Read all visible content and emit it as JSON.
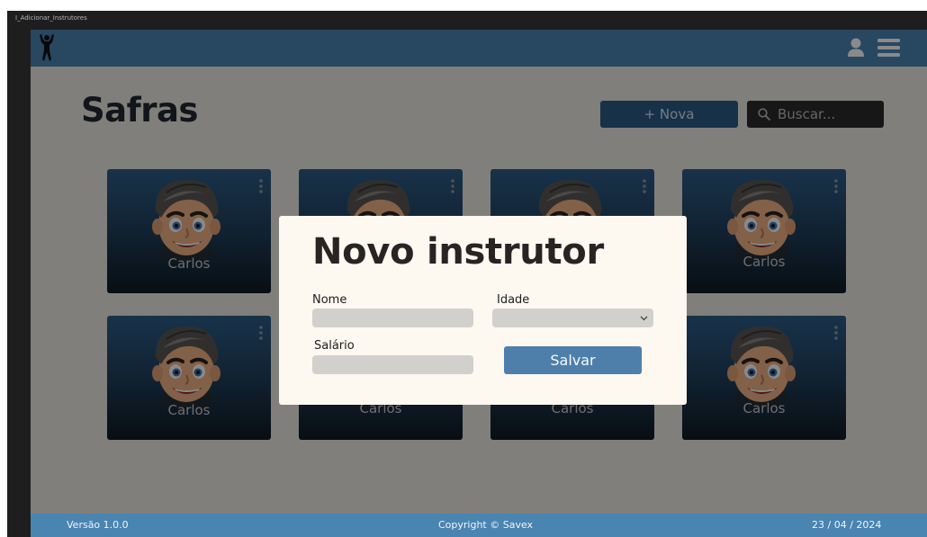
{
  "window": {
    "title": "I_Adicionar_Instrutores"
  },
  "header": {
    "logo_icon": "bodybuilder-icon",
    "user_icon": "user-icon",
    "menu_icon": "hamburger-menu-icon",
    "color": "#4a84b1"
  },
  "page": {
    "title": "Safras"
  },
  "toolbar": {
    "new_label": "+ Nova",
    "search_placeholder": "Buscar..."
  },
  "cards": [
    {
      "name": "Carlos"
    },
    {
      "name": "Carlos"
    },
    {
      "name": "Carlos"
    },
    {
      "name": "Carlos"
    },
    {
      "name": "Carlos"
    },
    {
      "name": "Carlos"
    },
    {
      "name": "Carlos"
    },
    {
      "name": "Carlos"
    }
  ],
  "modal": {
    "title": "Novo instrutor",
    "nome_label": "Nome",
    "idade_label": "Idade",
    "salario_label": "Salário",
    "save_label": "Salvar",
    "nome_value": "",
    "salario_value": "",
    "idade_value": ""
  },
  "footer": {
    "version": "Versão 1.0.0",
    "copyright": "Copyright © Savex",
    "date": "23 / 04 / 2024"
  }
}
